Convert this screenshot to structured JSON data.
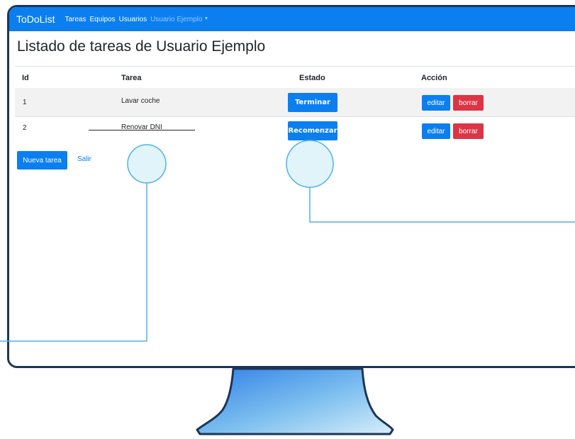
{
  "navbar": {
    "brand": "ToDoList",
    "links": [
      "Tareas",
      "Equipos",
      "Usuarios"
    ],
    "user_menu": "Usuario Ejemplo"
  },
  "page_title": "Listado de tareas de Usuario Ejemplo",
  "table": {
    "headers": [
      "Id",
      "Tarea",
      "Estado",
      "Acción"
    ],
    "rows": [
      {
        "id": "1",
        "task": "Lavar coche",
        "state_button": "Terminar",
        "edit": "editar",
        "delete": "borrar"
      },
      {
        "id": "2",
        "task": "Renovar DNI",
        "state_button": "Recomenzar",
        "edit": "editar",
        "delete": "borrar",
        "completed": true
      }
    ]
  },
  "actions": {
    "new_task": "Nueva tarea",
    "logout": "Salir"
  },
  "colors": {
    "primary": "#0b7ff0",
    "danger": "#dc3545",
    "frame": "#1e3557",
    "callout": "#4fb3e6"
  }
}
